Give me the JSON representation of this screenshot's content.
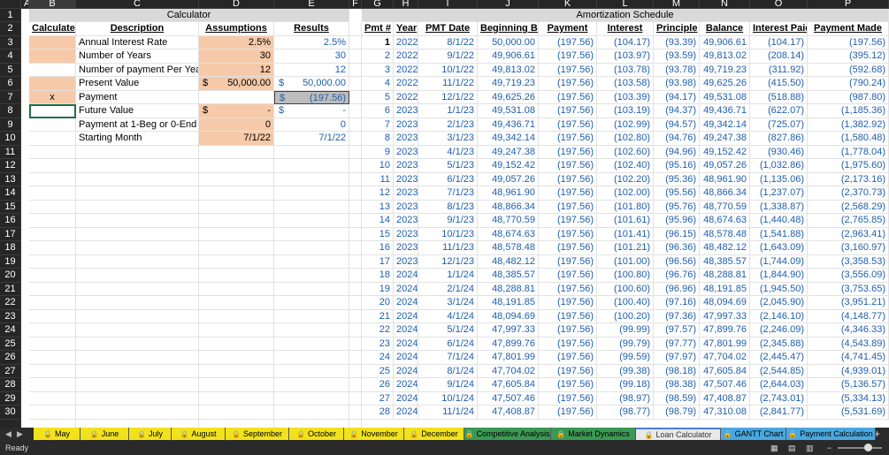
{
  "columns": [
    "A",
    "B",
    "C",
    "D",
    "E",
    "F",
    "G",
    "H",
    "I",
    "J",
    "K",
    "L",
    "M",
    "N",
    "O",
    "P"
  ],
  "calculator": {
    "title": "Calculator",
    "headers": {
      "calculate": "Calculate",
      "description": "Description",
      "assumptions": "Assumptions",
      "results": "Results"
    },
    "rows": [
      {
        "calc": "",
        "desc": "Annual Interest Rate",
        "assump": "2.5%",
        "result": "2.5%"
      },
      {
        "calc": "",
        "desc": "Number of Years",
        "assump": "30",
        "result": "30"
      },
      {
        "calc": "",
        "desc": "Number of payment Per Year",
        "assump": "12",
        "result": "12"
      },
      {
        "calc": "",
        "desc": "Present Value",
        "assump": "50,000.00",
        "assump_sym": "$",
        "result": "50,000.00",
        "result_sym": "$"
      },
      {
        "calc": "x",
        "desc": "Payment",
        "assump": "",
        "result": "(197.56)",
        "result_sym": "$"
      },
      {
        "calc": "",
        "desc": "Future Value",
        "assump": "-",
        "assump_sym": "$",
        "result": "-",
        "result_sym": "$"
      },
      {
        "calc": "",
        "desc": "Payment at 1-Beg or 0-End",
        "assump": "0",
        "result": "0"
      },
      {
        "calc": "",
        "desc": "Starting Month",
        "assump": "7/1/22",
        "result": "7/1/22"
      }
    ]
  },
  "amortization": {
    "title": "Amortization Schedule",
    "headers": [
      "Pmt #",
      "Year",
      "PMT Date",
      "Beginning Bal",
      "Payment",
      "Interest",
      "Principle",
      "Balance",
      "Interest Paid",
      "Payment Made"
    ],
    "rows": [
      [
        "1",
        "2022",
        "8/1/22",
        "50,000.00",
        "(197.56)",
        "(104.17)",
        "(93.39)",
        "49,906.61",
        "(104.17)",
        "(197.56)"
      ],
      [
        "2",
        "2022",
        "9/1/22",
        "49,906.61",
        "(197.56)",
        "(103.97)",
        "(93.59)",
        "49,813.02",
        "(208.14)",
        "(395.12)"
      ],
      [
        "3",
        "2022",
        "10/1/22",
        "49,813.02",
        "(197.56)",
        "(103.78)",
        "(93.78)",
        "49,719.23",
        "(311.92)",
        "(592.68)"
      ],
      [
        "4",
        "2022",
        "11/1/22",
        "49,719.23",
        "(197.56)",
        "(103.58)",
        "(93.98)",
        "49,625.26",
        "(415.50)",
        "(790.24)"
      ],
      [
        "5",
        "2022",
        "12/1/22",
        "49,625.26",
        "(197.56)",
        "(103.39)",
        "(94.17)",
        "49,531.08",
        "(518.88)",
        "(987.80)"
      ],
      [
        "6",
        "2023",
        "1/1/23",
        "49,531.08",
        "(197.56)",
        "(103.19)",
        "(94.37)",
        "49,436.71",
        "(622.07)",
        "(1,185.36)"
      ],
      [
        "7",
        "2023",
        "2/1/23",
        "49,436.71",
        "(197.56)",
        "(102.99)",
        "(94.57)",
        "49,342.14",
        "(725.07)",
        "(1,382.92)"
      ],
      [
        "8",
        "2023",
        "3/1/23",
        "49,342.14",
        "(197.56)",
        "(102.80)",
        "(94.76)",
        "49,247.38",
        "(827.86)",
        "(1,580.48)"
      ],
      [
        "9",
        "2023",
        "4/1/23",
        "49,247.38",
        "(197.56)",
        "(102.60)",
        "(94.96)",
        "49,152.42",
        "(930.46)",
        "(1,778.04)"
      ],
      [
        "10",
        "2023",
        "5/1/23",
        "49,152.42",
        "(197.56)",
        "(102.40)",
        "(95.16)",
        "49,057.26",
        "(1,032.86)",
        "(1,975.60)"
      ],
      [
        "11",
        "2023",
        "6/1/23",
        "49,057.26",
        "(197.56)",
        "(102.20)",
        "(95.36)",
        "48,961.90",
        "(1,135.06)",
        "(2,173.16)"
      ],
      [
        "12",
        "2023",
        "7/1/23",
        "48,961.90",
        "(197.56)",
        "(102.00)",
        "(95.56)",
        "48,866.34",
        "(1,237.07)",
        "(2,370.73)"
      ],
      [
        "13",
        "2023",
        "8/1/23",
        "48,866.34",
        "(197.56)",
        "(101.80)",
        "(95.76)",
        "48,770.59",
        "(1,338.87)",
        "(2,568.29)"
      ],
      [
        "14",
        "2023",
        "9/1/23",
        "48,770.59",
        "(197.56)",
        "(101.61)",
        "(95.96)",
        "48,674.63",
        "(1,440.48)",
        "(2,765.85)"
      ],
      [
        "15",
        "2023",
        "10/1/23",
        "48,674.63",
        "(197.56)",
        "(101.41)",
        "(96.15)",
        "48,578.48",
        "(1,541.88)",
        "(2,963.41)"
      ],
      [
        "16",
        "2023",
        "11/1/23",
        "48,578.48",
        "(197.56)",
        "(101.21)",
        "(96.36)",
        "48,482.12",
        "(1,643.09)",
        "(3,160.97)"
      ],
      [
        "17",
        "2023",
        "12/1/23",
        "48,482.12",
        "(197.56)",
        "(101.00)",
        "(96.56)",
        "48,385.57",
        "(1,744.09)",
        "(3,358.53)"
      ],
      [
        "18",
        "2024",
        "1/1/24",
        "48,385.57",
        "(197.56)",
        "(100.80)",
        "(96.76)",
        "48,288.81",
        "(1,844.90)",
        "(3,556.09)"
      ],
      [
        "19",
        "2024",
        "2/1/24",
        "48,288.81",
        "(197.56)",
        "(100.60)",
        "(96.96)",
        "48,191.85",
        "(1,945.50)",
        "(3,753.65)"
      ],
      [
        "20",
        "2024",
        "3/1/24",
        "48,191.85",
        "(197.56)",
        "(100.40)",
        "(97.16)",
        "48,094.69",
        "(2,045.90)",
        "(3,951.21)"
      ],
      [
        "21",
        "2024",
        "4/1/24",
        "48,094.69",
        "(197.56)",
        "(100.20)",
        "(97.36)",
        "47,997.33",
        "(2,146.10)",
        "(4,148.77)"
      ],
      [
        "22",
        "2024",
        "5/1/24",
        "47,997.33",
        "(197.56)",
        "(99.99)",
        "(97.57)",
        "47,899.76",
        "(2,246.09)",
        "(4,346.33)"
      ],
      [
        "23",
        "2024",
        "6/1/24",
        "47,899.76",
        "(197.56)",
        "(99.79)",
        "(97.77)",
        "47,801.99",
        "(2,345.88)",
        "(4,543.89)"
      ],
      [
        "24",
        "2024",
        "7/1/24",
        "47,801.99",
        "(197.56)",
        "(99.59)",
        "(97.97)",
        "47,704.02",
        "(2,445.47)",
        "(4,741.45)"
      ],
      [
        "25",
        "2024",
        "8/1/24",
        "47,704.02",
        "(197.56)",
        "(99.38)",
        "(98.18)",
        "47,605.84",
        "(2,544.85)",
        "(4,939.01)"
      ],
      [
        "26",
        "2024",
        "9/1/24",
        "47,605.84",
        "(197.56)",
        "(99.18)",
        "(98.38)",
        "47,507.46",
        "(2,644.03)",
        "(5,136.57)"
      ],
      [
        "27",
        "2024",
        "10/1/24",
        "47,507.46",
        "(197.56)",
        "(98.97)",
        "(98.59)",
        "47,408.87",
        "(2,743.01)",
        "(5,334.13)"
      ],
      [
        "28",
        "2024",
        "11/1/24",
        "47,408.87",
        "(197.56)",
        "(98.77)",
        "(98.79)",
        "47,310.08",
        "(2,841.77)",
        "(5,531.69)"
      ]
    ]
  },
  "tabs": [
    {
      "label": "May",
      "color": "#f2e21b",
      "locked": true
    },
    {
      "label": "June",
      "color": "#f2e21b",
      "locked": true
    },
    {
      "label": "July",
      "color": "#f2e21b",
      "locked": true
    },
    {
      "label": "August",
      "color": "#f2e21b",
      "locked": true
    },
    {
      "label": "September",
      "color": "#f2e21b",
      "locked": true
    },
    {
      "label": "October",
      "color": "#f2e21b",
      "locked": true
    },
    {
      "label": "November",
      "color": "#f2e21b",
      "locked": true
    },
    {
      "label": "December",
      "color": "#f2e21b",
      "locked": true
    },
    {
      "label": "Competitive Analysis",
      "color": "#3a9a55",
      "locked": true
    },
    {
      "label": "Market Dynamics",
      "color": "#3a9a55",
      "locked": true
    },
    {
      "label": "Loan Calculator",
      "color": "#e9e9e9",
      "locked": true,
      "active": true
    },
    {
      "label": "GANTT Chart",
      "color": "#4aa8e0",
      "locked": true
    },
    {
      "label": "Payment Calculation",
      "color": "#4aa8e0",
      "locked": true
    }
  ],
  "status": {
    "text": "Ready"
  },
  "colors": {
    "accent": "#1f5fad",
    "input_fill": "#f6caa9",
    "header_fill": "#d9d9d9"
  }
}
